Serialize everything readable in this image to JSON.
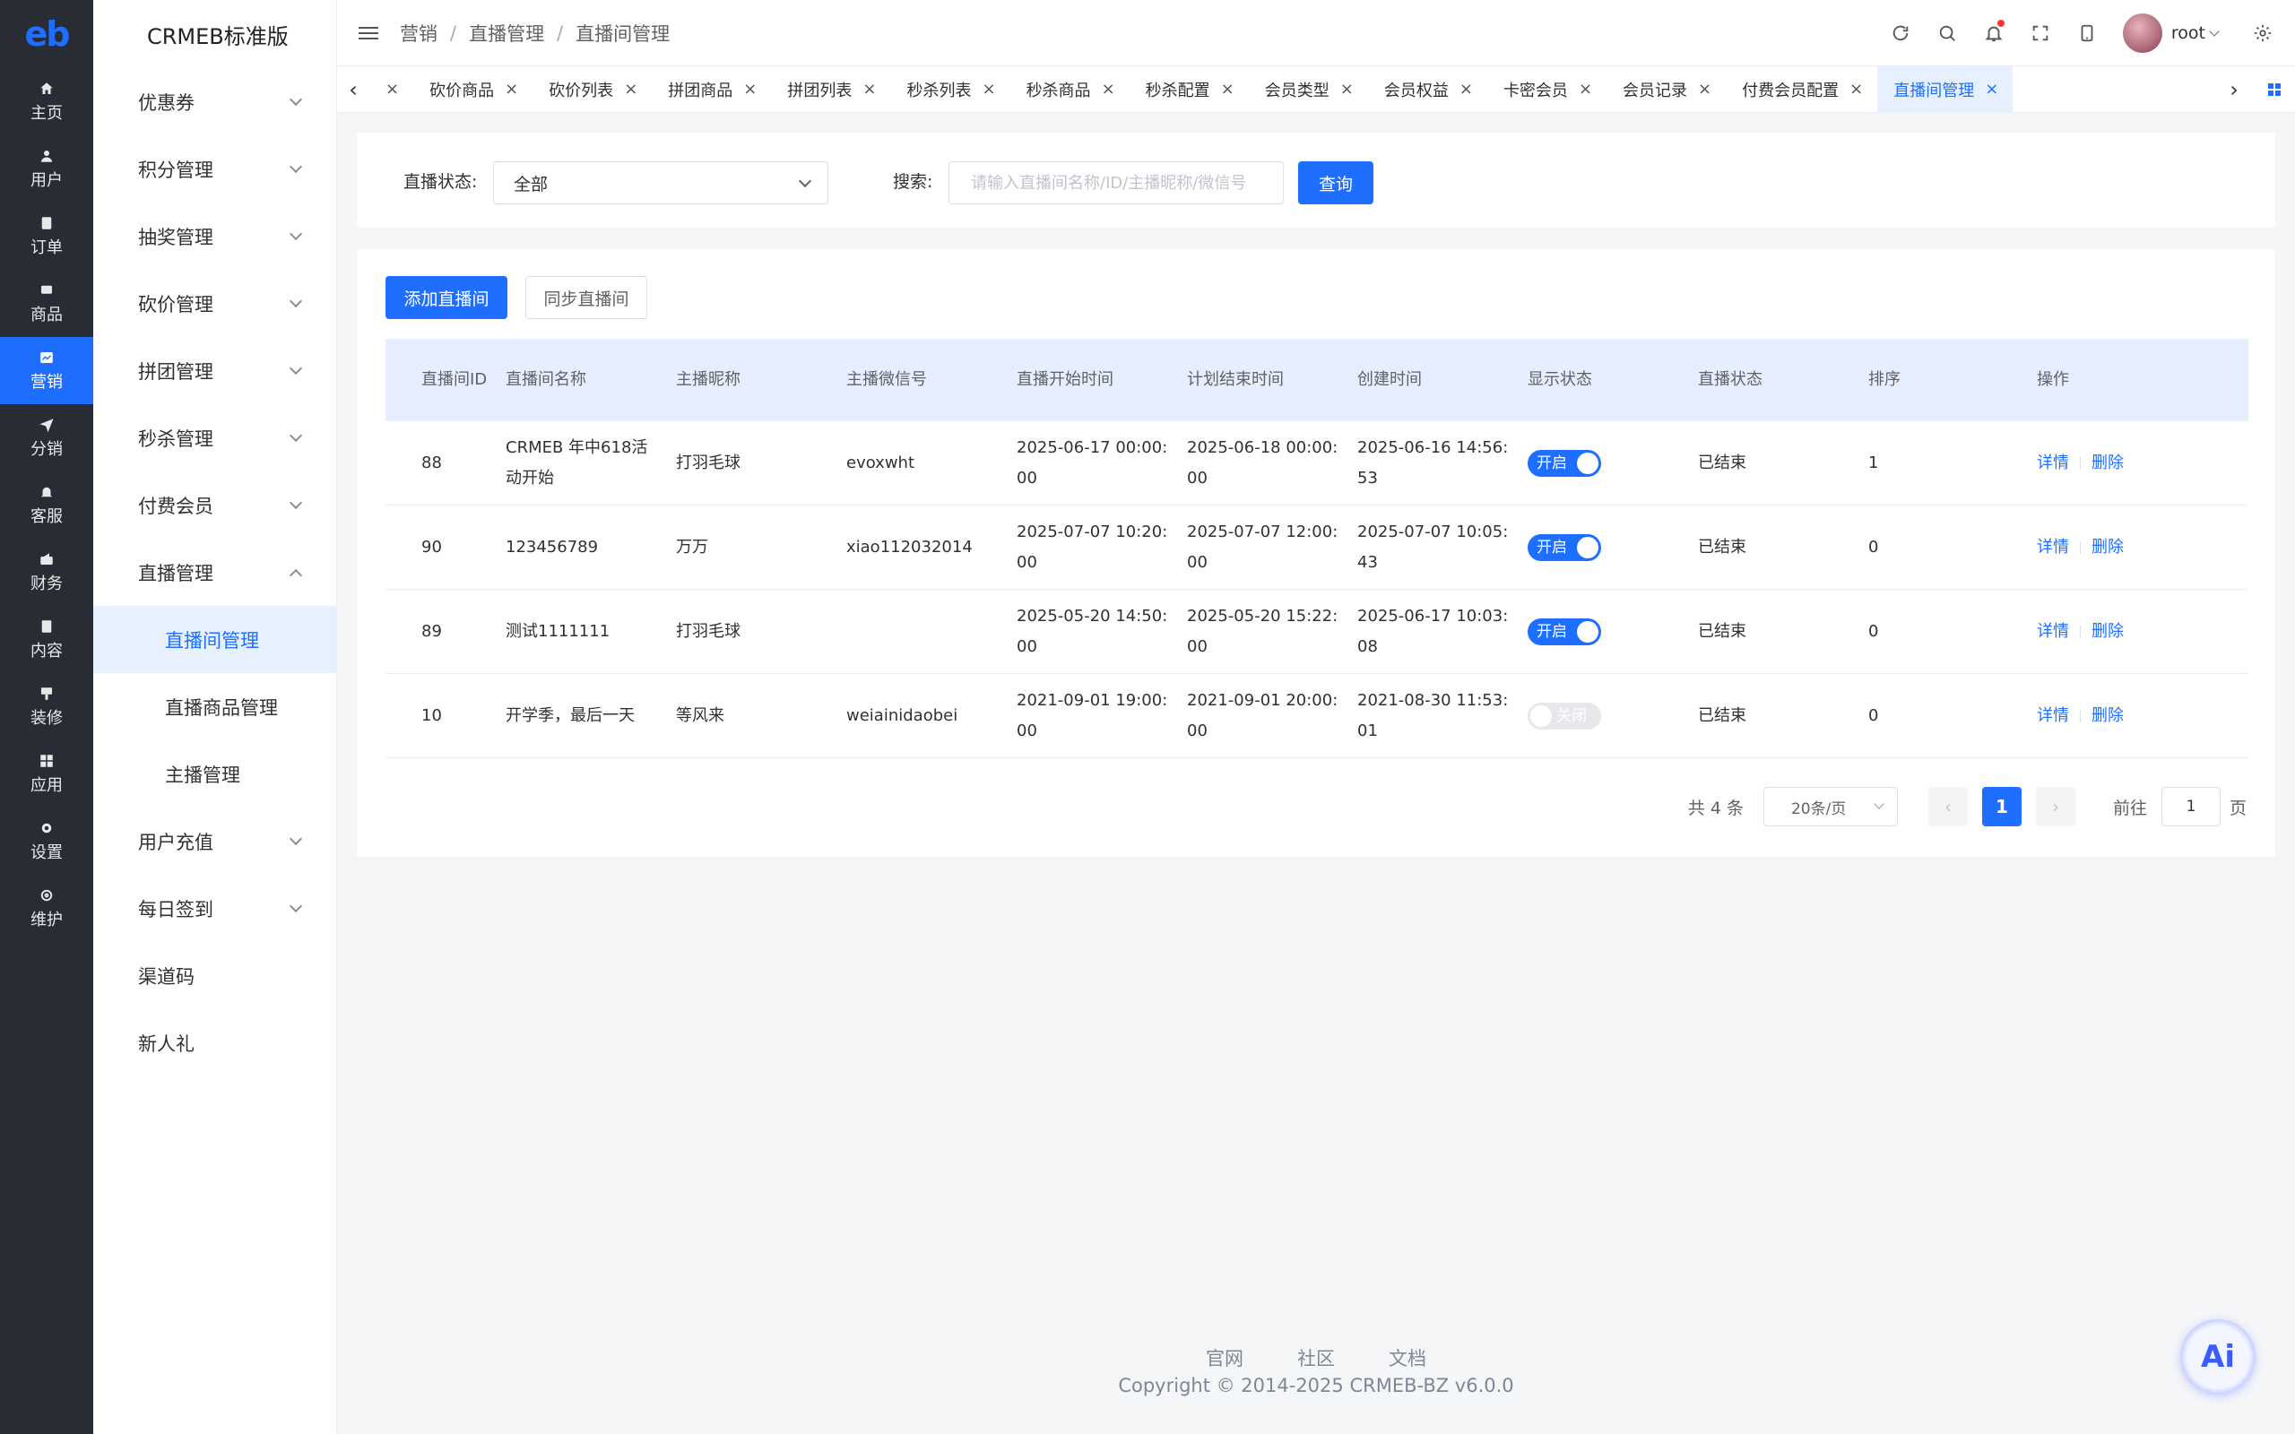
{
  "brand": {
    "logo_text": "eb",
    "app_title": "CRMEB标准版"
  },
  "rail": [
    {
      "label": "主页",
      "icon": "home-icon"
    },
    {
      "label": "用户",
      "icon": "user-icon"
    },
    {
      "label": "订单",
      "icon": "order-icon"
    },
    {
      "label": "商品",
      "icon": "product-icon"
    },
    {
      "label": "营销",
      "icon": "marketing-icon",
      "active": true
    },
    {
      "label": "分销",
      "icon": "send-icon"
    },
    {
      "label": "客服",
      "icon": "bell-icon"
    },
    {
      "label": "财务",
      "icon": "finance-icon"
    },
    {
      "label": "内容",
      "icon": "content-icon"
    },
    {
      "label": "装修",
      "icon": "decorate-icon"
    },
    {
      "label": "应用",
      "icon": "apps-icon"
    },
    {
      "label": "设置",
      "icon": "gear-icon"
    },
    {
      "label": "维护",
      "icon": "maintain-icon"
    }
  ],
  "submenu": {
    "items": [
      "优惠券",
      "积分管理",
      "抽奖管理",
      "砍价管理",
      "拼团管理",
      "秒杀管理",
      "付费会员",
      "直播管理"
    ],
    "children": [
      "直播间管理",
      "直播商品管理",
      "主播管理"
    ],
    "after": [
      "用户充值",
      "每日签到"
    ],
    "plain": [
      "渠道码",
      "新人礼"
    ]
  },
  "breadcrumb": [
    "营销",
    "直播管理",
    "直播间管理"
  ],
  "user": {
    "name": "root"
  },
  "tabs": [
    "砍价商品",
    "砍价列表",
    "拼团商品",
    "拼团列表",
    "秒杀列表",
    "秒杀商品",
    "秒杀配置",
    "会员类型",
    "会员权益",
    "卡密会员",
    "会员记录",
    "付费会员配置",
    "直播间管理"
  ],
  "filter": {
    "status_label": "直播状态:",
    "status_value": "全部",
    "search_label": "搜索:",
    "search_placeholder": "请输入直播间名称/ID/主播昵称/微信号",
    "query_button": "查询"
  },
  "actions": {
    "add_button": "添加直播间",
    "sync_button": "同步直播间"
  },
  "table": {
    "columns": [
      "直播间ID",
      "直播间名称",
      "主播昵称",
      "主播微信号",
      "直播开始时间",
      "计划结束时间",
      "创建时间",
      "显示状态",
      "直播状态",
      "排序",
      "操作"
    ],
    "rows": [
      {
        "id": "88",
        "name": "CRMEB 年中618活动开始",
        "anchor": "打羽毛球",
        "wechat": "evoxwht",
        "start": "2025-06-17 00:00:00",
        "end": "2025-06-18 00:00:00",
        "created": "2025-06-16 14:56:53",
        "show": "开启",
        "show_on": true,
        "status": "已结束",
        "sort": "1"
      },
      {
        "id": "90",
        "name": "123456789",
        "anchor": "万万",
        "wechat": "xiao112032014",
        "start": "2025-07-07 10:20:00",
        "end": "2025-07-07 12:00:00",
        "created": "2025-07-07 10:05:43",
        "show": "开启",
        "show_on": true,
        "status": "已结束",
        "sort": "0"
      },
      {
        "id": "89",
        "name": "测试1111111",
        "anchor": "打羽毛球",
        "wechat": "",
        "start": "2025-05-20 14:50:00",
        "end": "2025-05-20 15:22:00",
        "created": "2025-06-17 10:03:08",
        "show": "开启",
        "show_on": true,
        "status": "已结束",
        "sort": "0"
      },
      {
        "id": "10",
        "name": "开学季，最后一天",
        "anchor": "等风来",
        "wechat": "weiainidaobei",
        "start": "2021-09-01 19:00:00",
        "end": "2021-09-01 20:00:00",
        "created": "2021-08-30 11:53:01",
        "show": "关闭",
        "show_on": false,
        "status": "已结束",
        "sort": "0"
      }
    ],
    "op_detail": "详情",
    "op_delete": "删除"
  },
  "pager": {
    "total": "共 4 条",
    "size": "20条/页",
    "prev": "‹",
    "page": "1",
    "next": "›",
    "goto": "前往",
    "goto_value": "1",
    "page_unit": "页"
  },
  "footer": {
    "links": [
      "官网",
      "社区",
      "文档"
    ],
    "copyright": "Copyright © 2014-2025 CRMEB-BZ v6.0.0"
  },
  "ai_label": "Ai",
  "colors": {
    "primary": "#1e6fff",
    "rail_bg": "#282c34",
    "header_row_bg": "#e6efff"
  }
}
